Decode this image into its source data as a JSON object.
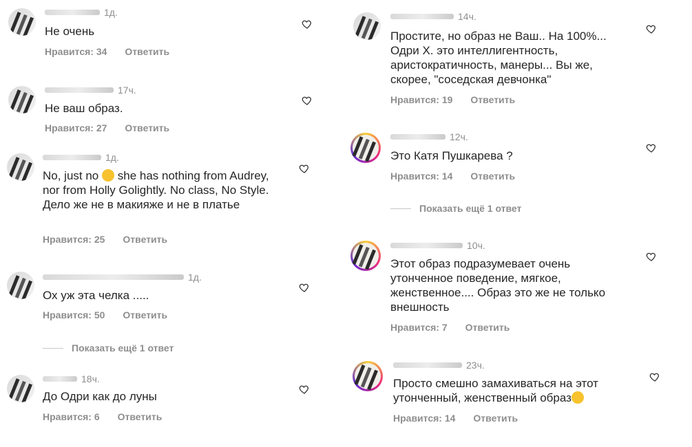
{
  "left": [
    {
      "time": "1д.",
      "text": "Не очень",
      "likes": "Нравится: 34",
      "reply": "Ответить"
    },
    {
      "time": "17ч.",
      "text": "Не ваш образ.",
      "likes": "Нравится: 27",
      "reply": "Ответить"
    },
    {
      "time": "1д.",
      "text_line1": "No, just no",
      "text_line1b": "she has nothing from",
      "text_rest": "Audrey, nor from Holly Golightly. No class, No Style. Дело же не в макияже и не в платье",
      "likes": "Нравится: 25",
      "reply": "Ответить"
    },
    {
      "time": "1д.",
      "text": "Ох уж эта челка .....",
      "likes": "Нравится: 50",
      "reply": "Ответить",
      "more": "Показать ещё 1 ответ"
    },
    {
      "time": "18ч.",
      "text": "До Одри как до луны",
      "likes": "Нравится: 6",
      "reply": "Ответить"
    }
  ],
  "right": [
    {
      "time": "14ч.",
      "text": "Простите, но образ не Ваш.. На 100%... Одри Х. это интеллигентность, аристократичность, манеры... Вы же, скорее, \"соседская девчонка\"",
      "likes": "Нравится: 19",
      "reply": "Ответить"
    },
    {
      "time": "12ч.",
      "text": "Это Катя Пушкарева ?",
      "likes": "Нравится: 14",
      "reply": "Ответить",
      "more": "Показать ещё 1 ответ"
    },
    {
      "time": "10ч.",
      "text": "Этот образ подразумевает очень утонченное поведение, мягкое, женственное.... Образ это же не только внешность",
      "likes": "Нравится: 7",
      "reply": "Ответить"
    },
    {
      "time": "23ч.",
      "text": "Просто смешно замахиваться на этот утонченный, женственный образ",
      "likes": "Нравится: 14",
      "reply": "Ответить"
    }
  ],
  "icons": {
    "like": "heart-icon",
    "emoji_confused": "confused-face-emoji",
    "emoji_laugh": "laughing-tears-emoji"
  }
}
